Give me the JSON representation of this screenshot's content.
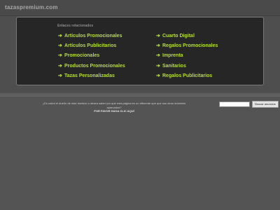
{
  "header": {
    "domain": "tazaspremium.com"
  },
  "panel": {
    "title": "Enlaces relacionados",
    "arrow_icon": "arrow-right-icon",
    "left_links": [
      "Artículos Promocionales",
      "Artículos Publicitarios",
      "Promocionales",
      "Productos Promocionales",
      "Tazas Personalizadas"
    ],
    "right_links": [
      "Cuarto Digital",
      "Regalos Promocionales",
      "Imprenta",
      "Sanitarios",
      "Regalos Publicitarios"
    ]
  },
  "footer": {
    "notice": "¿Es usted el dueño de este dominio o desea saber por qué esta página es un diferente que que sus otros dominios aparcados?",
    "cta": "POR FAVOR HAGA CLIC AQUÍ",
    "search_placeholder": "",
    "search_button": "Buscar anuncios"
  },
  "colors": {
    "background": "#545454",
    "panel": "#262626",
    "link": "#b4e03a"
  }
}
